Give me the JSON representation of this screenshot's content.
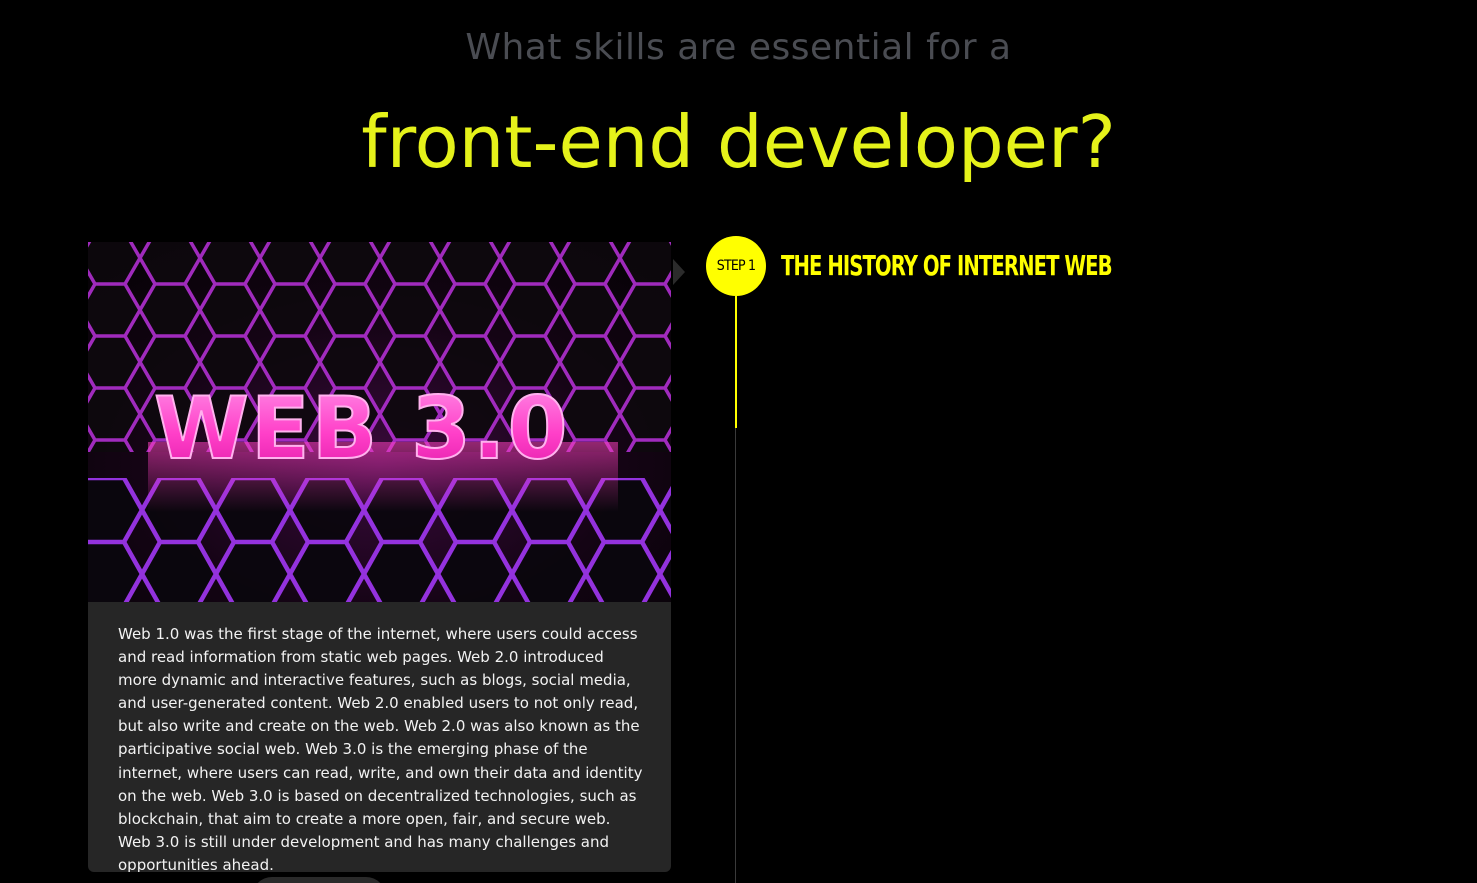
{
  "header": {
    "subtitle": "What skills are essential for a",
    "title": "front-end developer?"
  },
  "step": {
    "badge": "STEP 1",
    "title": "THE HISTORY OF INTERNET WEB"
  },
  "card": {
    "image_text": "WEB 3.0",
    "body": "Web 1.0 was the first stage of the internet, where users could access and read information from static web pages. Web 2.0 introduced more dynamic and interactive features, such as blogs, social media, and user-generated content. Web 2.0 enabled users to not only read, but also write and create on the web. Web 2.0 was also known as the participative social web. Web 3.0 is the emerging phase of the internet, where users can read, write, and own their data and identity on the web. Web 3.0 is based on decentralized technologies, such as blockchain, that aim to create a more open, fair, and secure web. Web 3.0 is still under development and has many challenges and opportunities ahead."
  },
  "colors": {
    "accent": "#ffff00",
    "headline": "#e5f21a",
    "subtitle": "#4a4c52",
    "card_bg": "#262626",
    "page_bg": "#000000",
    "hex_glow": "#c23fe0"
  }
}
